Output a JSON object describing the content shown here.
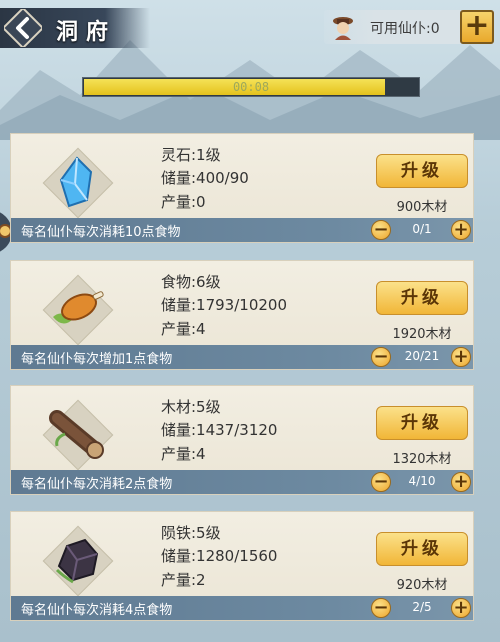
{
  "header": {
    "title": "洞府",
    "servant_label": "可用仙仆:0",
    "add_symbol": "+"
  },
  "timer": {
    "text": "00:08",
    "progress": 0.9
  },
  "resources": [
    {
      "id": "spirit-stone",
      "icon": "spirit-stone-crystal-icon",
      "name": "灵石:1级",
      "capacity": "储量:400/90",
      "production": "产量:0",
      "upgrade_label": "升级",
      "cost": "900木材",
      "footer": "每名仙仆每次消耗10点食物",
      "count": "0/1"
    },
    {
      "id": "food",
      "icon": "roast-drumstick-icon",
      "name": "食物:6级",
      "capacity": "储量:1793/10200",
      "production": "产量:4",
      "upgrade_label": "升级",
      "cost": "1920木材",
      "footer": "每名仙仆每次增加1点食物",
      "count": "20/21"
    },
    {
      "id": "wood",
      "icon": "wood-log-icon",
      "name": "木材:5级",
      "capacity": "储量:1437/3120",
      "production": "产量:4",
      "upgrade_label": "升级",
      "cost": "1320木材",
      "footer": "每名仙仆每次消耗2点食物",
      "count": "4/10"
    },
    {
      "id": "meteor-iron",
      "icon": "meteor-iron-ore-icon",
      "name": "陨铁:5级",
      "capacity": "储量:1280/1560",
      "production": "产量:2",
      "upgrade_label": "升级",
      "cost": "920木材",
      "footer": "每名仙仆每次消耗4点食物",
      "count": "2/5"
    }
  ],
  "controls": {
    "minus": "−",
    "plus": "+"
  }
}
